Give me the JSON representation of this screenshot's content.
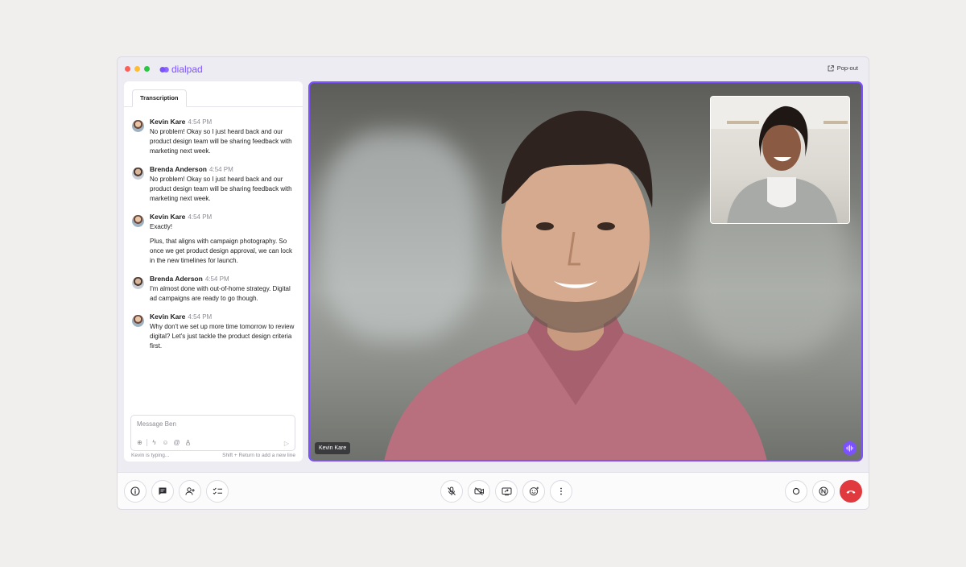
{
  "app": {
    "brand": "dialpad",
    "popout_label": "Pop-out",
    "accent_color": "#7c52ff",
    "window_dots": [
      "#ff5f57",
      "#febc2e",
      "#28c840"
    ]
  },
  "transcript": {
    "tab_label": "Transcription",
    "messages": [
      {
        "author": "Kevin Kare",
        "time": "4:54 PM",
        "lines": [
          "No problem! Okay so I just heard back and our product design team will be sharing feedback with marketing next week."
        ]
      },
      {
        "author": "Brenda Anderson",
        "time": "4:54 PM",
        "lines": [
          "No problem! Okay so I just heard back and our product design team will be sharing feedback with marketing next week."
        ]
      },
      {
        "author": "Kevin Kare",
        "time": "4:54 PM",
        "lines": [
          "Exactly!",
          "Plus, that aligns with campaign photography. So once we get product design approval, we can lock in the new timelines for launch."
        ]
      },
      {
        "author": "Brenda Aderson",
        "time": "4:54 PM",
        "lines": [
          "I'm almost done with out-of-home strategy. Digital ad campaigns are ready to go though."
        ]
      },
      {
        "author": "Kevin Kare",
        "time": "4:54 PM",
        "lines": [
          "Why don't we set up more time tomorrow to review digital? Let's just tackle the product design criteria first."
        ]
      }
    ],
    "composer": {
      "placeholder": "Message Ben",
      "typing_status": "Kevin is typing...",
      "hint": "Shift + Return to add a new line"
    }
  },
  "video": {
    "speaker_name": "Kevin Kare"
  },
  "controls": {
    "left": [
      "info-icon",
      "chat-icon",
      "people-icon",
      "checklist-icon"
    ],
    "center": [
      "mic-off-icon",
      "video-off-icon",
      "screen-share-icon",
      "reaction-icon",
      "more-icon"
    ],
    "right": [
      "record-icon",
      "ai-icon",
      "end-call-icon"
    ],
    "end_call_color": "#e0393e"
  }
}
